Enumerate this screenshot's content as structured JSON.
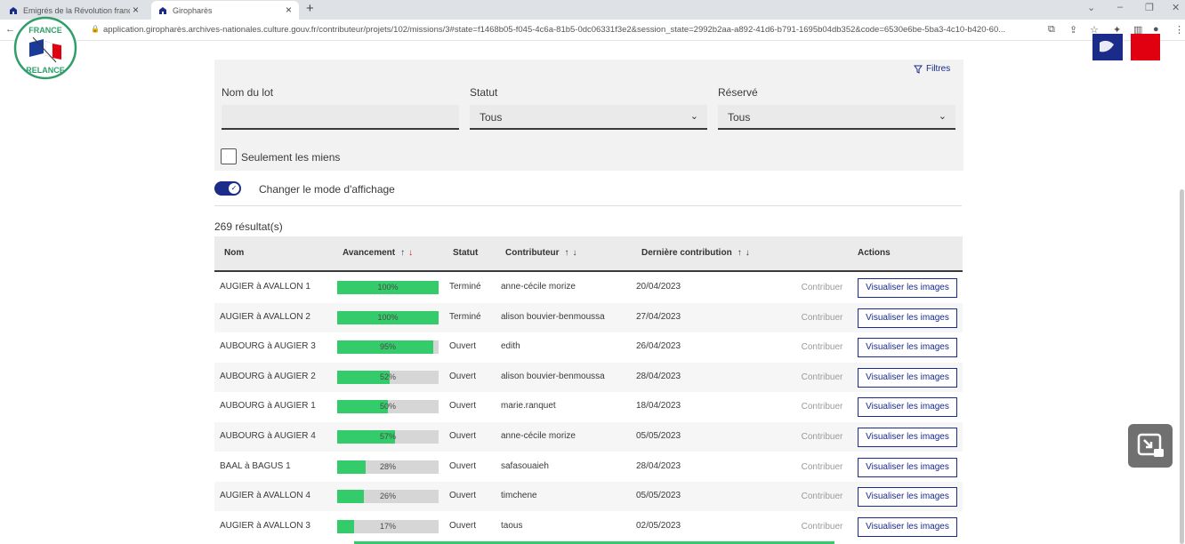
{
  "browser": {
    "tabs": [
      {
        "title": "Emigrés de la Révolution françai",
        "active": false
      },
      {
        "title": "Giropharès",
        "active": true
      }
    ],
    "url": "application.giropharès.archives-nationales.culture.gouv.fr/contributeur/projets/102/missions/3#state=f1468b05-f045-4c6a-81b5-0dc06331f3e2&session_state=2992b2aa-a892-41d6-b791-1695b04db352&code=6530e6be-5ba3-4c10-b420-60..."
  },
  "filters": {
    "button_label": "Filtres",
    "nom_du_lot_label": "Nom du lot",
    "nom_du_lot_value": "",
    "statut_label": "Statut",
    "statut_value": "Tous",
    "reserve_label": "Réservé",
    "reserve_value": "Tous",
    "seulement_label": "Seulement les miens"
  },
  "display_toggle_label": "Changer le mode d'affichage",
  "results_count": "269 résultat(s)",
  "table": {
    "headers": {
      "nom": "Nom",
      "avancement": "Avancement",
      "statut": "Statut",
      "contributeur": "Contributeur",
      "derniere": "Dernière contribution",
      "actions": "Actions"
    },
    "contribuer_label": "Contribuer",
    "visualiser_label": "Visualiser les images",
    "rows": [
      {
        "nom": "AUGIER à AVALLON 1",
        "progress": 100,
        "progress_label": "100%",
        "statut": "Terminé",
        "contributeur": "anne-cécile morize",
        "date": "20/04/2023"
      },
      {
        "nom": "AUGIER à AVALLON 2",
        "progress": 100,
        "progress_label": "100%",
        "statut": "Terminé",
        "contributeur": "alison bouvier-benmoussa",
        "date": "27/04/2023"
      },
      {
        "nom": "AUBOURG à AUGIER 3",
        "progress": 95,
        "progress_label": "95%",
        "statut": "Ouvert",
        "contributeur": "edith",
        "date": "26/04/2023"
      },
      {
        "nom": "AUBOURG à AUGIER 2",
        "progress": 52,
        "progress_label": "52%",
        "statut": "Ouvert",
        "contributeur": "alison bouvier-benmoussa",
        "date": "28/04/2023"
      },
      {
        "nom": "AUBOURG à AUGIER 1",
        "progress": 50,
        "progress_label": "50%",
        "statut": "Ouvert",
        "contributeur": "marie.ranquet",
        "date": "18/04/2023"
      },
      {
        "nom": "AUBOURG à AUGIER 4",
        "progress": 57,
        "progress_label": "57%",
        "statut": "Ouvert",
        "contributeur": "anne-cécile morize",
        "date": "05/05/2023"
      },
      {
        "nom": "BAAL à BAGUS 1",
        "progress": 28,
        "progress_label": "28%",
        "statut": "Ouvert",
        "contributeur": "safasouaieh",
        "date": "28/04/2023"
      },
      {
        "nom": "AUGIER à AVALLON 4",
        "progress": 26,
        "progress_label": "26%",
        "statut": "Ouvert",
        "contributeur": "timchene",
        "date": "05/05/2023"
      },
      {
        "nom": "AUGIER à AVALLON 3",
        "progress": 17,
        "progress_label": "17%",
        "statut": "Ouvert",
        "contributeur": "taous",
        "date": "02/05/2023"
      }
    ]
  },
  "logos": {
    "france_relance_text": [
      "FRANCE",
      "RELANCE"
    ]
  },
  "colors": {
    "progress_green": "#34cb6b",
    "primary_blue": "#1a2b8a",
    "sort_active_red": "#c9191e"
  }
}
